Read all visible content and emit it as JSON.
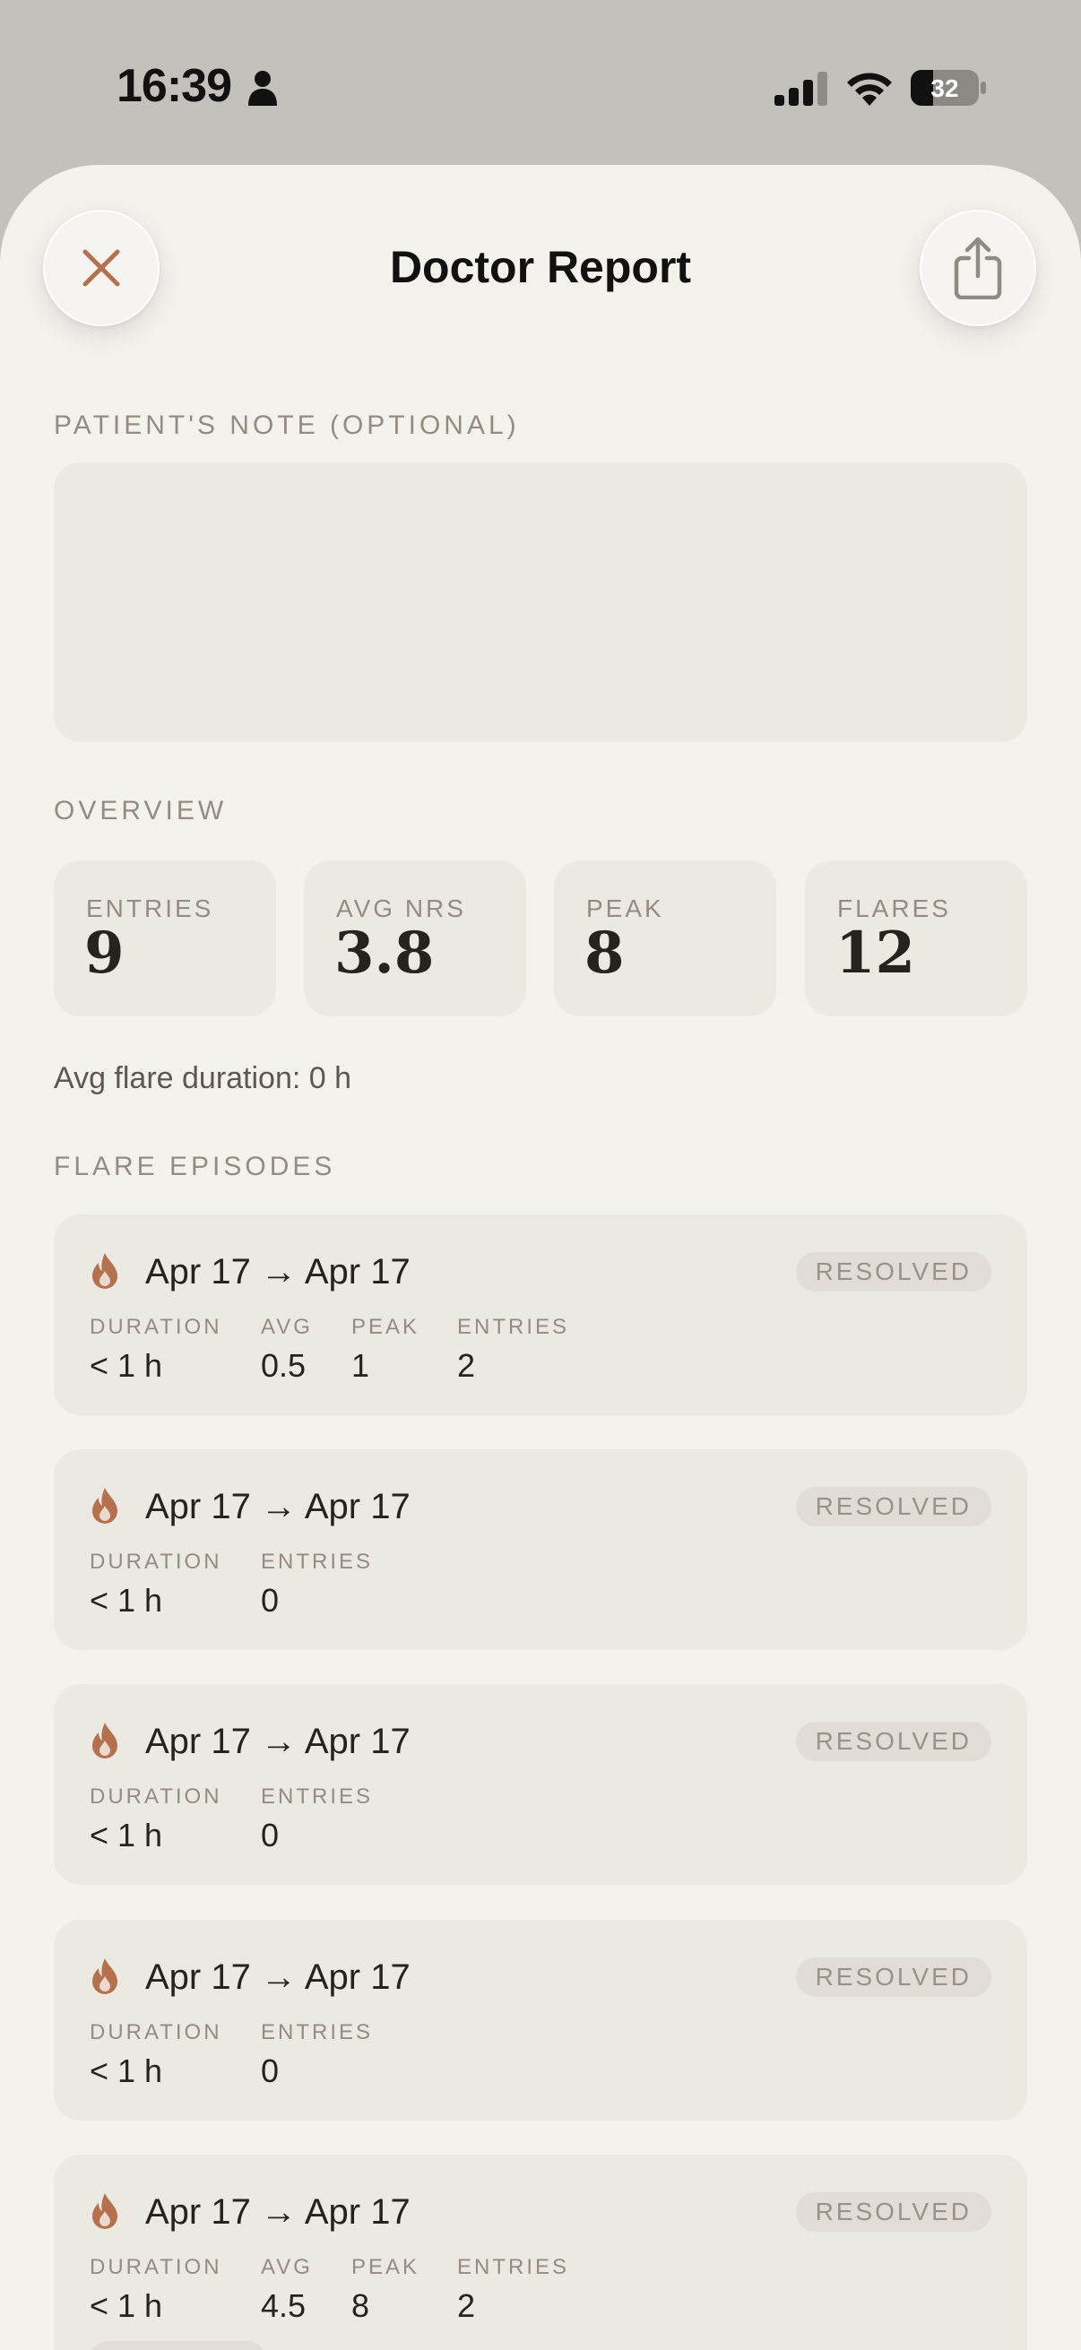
{
  "status_bar": {
    "time": "16:39",
    "battery": "32"
  },
  "header": {
    "title": "Doctor Report",
    "close_icon": "close-icon",
    "share_icon": "share-icon"
  },
  "note": {
    "label": "PATIENT'S NOTE (OPTIONAL)",
    "value": ""
  },
  "overview": {
    "label": "OVERVIEW",
    "stats": [
      {
        "label": "ENTRIES",
        "value": "9"
      },
      {
        "label": "AVG NRS",
        "value": "3.8"
      },
      {
        "label": "PEAK",
        "value": "8"
      },
      {
        "label": "FLARES",
        "value": "12"
      }
    ],
    "avg_flare_duration": "Avg flare duration: 0 h"
  },
  "flare_episodes": {
    "label": "FLARE EPISODES",
    "items": [
      {
        "range": "Apr 17 → Apr 17",
        "status": "RESOLVED",
        "duration_label": "DURATION",
        "duration": "< 1 h",
        "avg_label": "AVG",
        "avg": "0.5",
        "peak_label": "PEAK",
        "peak": "1",
        "entries_label": "ENTRIES",
        "entries": "2"
      },
      {
        "range": "Apr 17 → Apr 17",
        "status": "RESOLVED",
        "duration_label": "DURATION",
        "duration": "< 1 h",
        "entries_label": "ENTRIES",
        "entries": "0"
      },
      {
        "range": "Apr 17 → Apr 17",
        "status": "RESOLVED",
        "duration_label": "DURATION",
        "duration": "< 1 h",
        "entries_label": "ENTRIES",
        "entries": "0"
      },
      {
        "range": "Apr 17 → Apr 17",
        "status": "RESOLVED",
        "duration_label": "DURATION",
        "duration": "< 1 h",
        "entries_label": "ENTRIES",
        "entries": "0"
      },
      {
        "range": "Apr 17 → Apr 17",
        "status": "RESOLVED",
        "duration_label": "DURATION",
        "duration": "< 1 h",
        "avg_label": "AVG",
        "avg": "4.5",
        "peak_label": "PEAK",
        "peak": "8",
        "entries_label": "ENTRIES",
        "entries": "2"
      }
    ]
  },
  "colors": {
    "sheet_background": "#f4f2ed",
    "card_background": "#ece9e3",
    "accent_flame": "#b5714e",
    "muted_label": "#948c82"
  }
}
